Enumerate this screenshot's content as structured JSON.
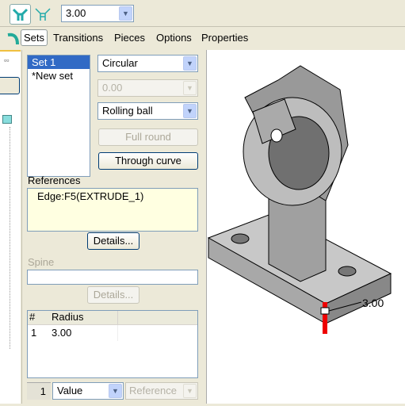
{
  "toolbar": {
    "radius_value": "3.00",
    "icons": [
      "round-set-mode-icon",
      "round-transition-mode-icon"
    ]
  },
  "tabs": [
    {
      "label": "Sets",
      "active": true
    },
    {
      "label": "Transitions"
    },
    {
      "label": "Pieces"
    },
    {
      "label": "Options"
    },
    {
      "label": "Properties"
    }
  ],
  "sets": {
    "items": [
      "Set 1",
      "*New set"
    ],
    "selected": 0
  },
  "shape": {
    "cross_section": "Circular",
    "conic_value": "0.00",
    "method": "Rolling ball",
    "full_round": "Full round",
    "through_curve": "Through curve"
  },
  "references": {
    "label": "References",
    "items": [
      "Edge:F5(EXTRUDE_1)"
    ],
    "details": "Details..."
  },
  "spine": {
    "label": "Spine",
    "value": "",
    "details": "Details..."
  },
  "radius_table": {
    "columns": [
      "#",
      "Radius"
    ],
    "rows": [
      [
        "1",
        "3.00"
      ]
    ]
  },
  "bottom": {
    "index": "1",
    "mode": "Value",
    "reference": "Reference"
  },
  "viewport": {
    "dimension_label": "3.00"
  }
}
